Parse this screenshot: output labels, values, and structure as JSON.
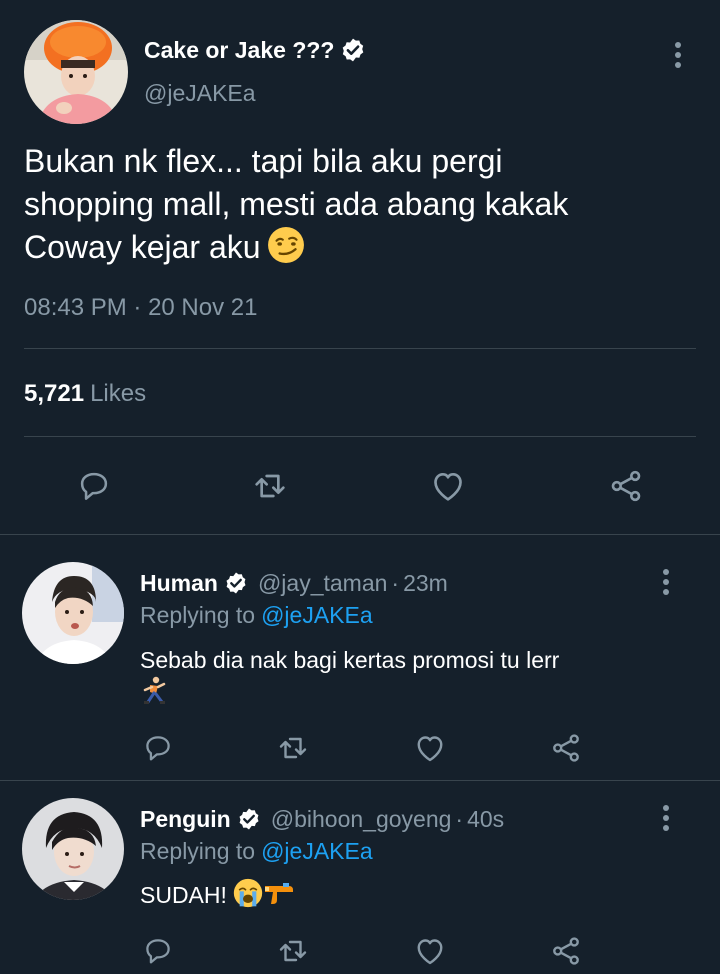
{
  "main_tweet": {
    "display_name": "Cake or Jake ???",
    "handle": "@jeJAKEa",
    "verified": true,
    "text": "Bukan nk flex... tapi bila aku pergi\nshopping mall, mesti ada abang kakak\nCoway kejar aku",
    "text_emoji": "smirking-face",
    "time": "08:43 PM",
    "date": "20 Nov 21",
    "time_separator": " · ",
    "likes_count": "5,721",
    "likes_label": "Likes"
  },
  "replies": [
    {
      "display_name": "Human",
      "handle": "@jay_taman",
      "separator": "·",
      "time": "23m",
      "verified": true,
      "replying_label": "Replying to",
      "replying_to": "@jeJAKEa",
      "text": "Sebab dia nak bagi kertas promosi tu lerr",
      "emoji": "person-running-emoji"
    },
    {
      "display_name": "Penguin",
      "handle": "@bihoon_goyeng",
      "separator": "·",
      "time": "40s",
      "verified": true,
      "replying_label": "Replying to",
      "replying_to": "@jeJAKEa",
      "text": "SUDAH!",
      "emoji": "loudly-crying-face-and-water-pistol"
    }
  ],
  "icons": {
    "reply": "reply-icon",
    "retweet": "retweet-icon",
    "like": "heart-icon",
    "share": "share-icon",
    "more": "more-vertical-icon",
    "verified": "verified-badge-icon"
  },
  "colors": {
    "background": "#15202b",
    "divider": "#38444d",
    "secondary_text": "#8899a6",
    "link": "#1da1f2",
    "icon": "#8899a6"
  }
}
